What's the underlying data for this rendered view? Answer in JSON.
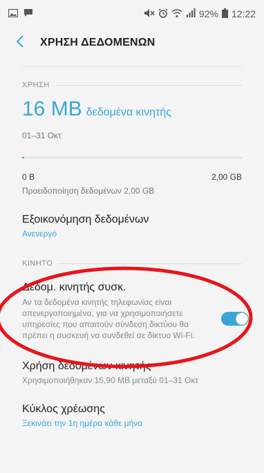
{
  "status_bar": {
    "battery": "92%",
    "time": "12:22"
  },
  "app_bar": {
    "title": "ΧΡΗΣΗ ΔΕΔΟΜΕΝΩΝ"
  },
  "usage": {
    "section_label": "ΧΡΗΣΗ",
    "amount": "16 MB",
    "amount_label": "δεδομένα κινητής",
    "date_range": "01–31 Οκτ",
    "progress_fraction": 0.008,
    "bar_min": "0 B",
    "bar_max": "2,00 GB",
    "warning": "Προειδοποίηση δεδομένων 2,00 GB"
  },
  "data_saver": {
    "title": "Εξοικονόμηση δεδομένων",
    "status": "Ανενεργό"
  },
  "mobile": {
    "section_label": "ΚΙΝΗΤΟ",
    "toggle_title": "Δεδομ. κινητής συσκ.",
    "toggle_desc": "Αν τα δεδομένα κινητής τηλεφωνίας είναι απενεργοποιημένα, για να χρησιμοποιήσετε υπηρεσίες που απαιτούν σύνδεση δικτύου θα πρέπει η συσκευή να συνδεθεί σε δίκτυο Wi-Fi.",
    "toggle_on": true,
    "usage_title": "Χρήση δεδομένων κινητής",
    "usage_sub": "Χρησιμοποιήθηκαν 15,90 MB μεταξύ 01–31 Οκτ",
    "cycle_title": "Κύκλος χρέωσης",
    "cycle_sub": "Ξεκινάει την 1η ημέρα κάθε μήνα"
  },
  "colors": {
    "accent": "#3aa6d8",
    "annotation": "#e8141b",
    "background": "#f4f4f4"
  },
  "icons": {
    "status_left": [
      "gallery-icon",
      "message-icon"
    ],
    "status_right": [
      "mute-icon",
      "alarm-icon",
      "wifi-icon",
      "signal-icon",
      "battery-icon"
    ],
    "back": "back-arrow-icon"
  }
}
